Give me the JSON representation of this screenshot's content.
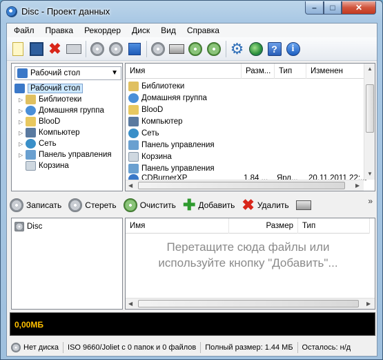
{
  "window": {
    "title": "Disc - Проект данных",
    "minimize": "–",
    "maximize": "□",
    "close": "✕"
  },
  "menu": [
    "Файл",
    "Правка",
    "Рекордер",
    "Диск",
    "Вид",
    "Справка"
  ],
  "tree": {
    "combo_value": "Рабочий стол",
    "root": "Рабочий стол",
    "items": [
      "Библиотеки",
      "Домашняя группа",
      "BlooD",
      "Компьютер",
      "Сеть",
      "Панель управления",
      "Корзина"
    ]
  },
  "file_list": {
    "columns": [
      "Имя",
      "Разм...",
      "Тип",
      "Изменен"
    ],
    "rows": [
      {
        "name": "Библиотеки"
      },
      {
        "name": "Домашняя группа"
      },
      {
        "name": "BlooD"
      },
      {
        "name": "Компьютер"
      },
      {
        "name": "Сеть"
      },
      {
        "name": "Панель управления"
      },
      {
        "name": "Корзина"
      },
      {
        "name": "Панель управления"
      }
    ],
    "partial_row": {
      "name": "CDBurnerXP",
      "size": "1,84 ...",
      "type": "Ярл...",
      "modified": "20.11.2011 22:..."
    }
  },
  "actions": {
    "burn": "Записать",
    "erase": "Стереть",
    "clear": "Очистить",
    "add": "Добавить",
    "delete": "Удалить",
    "more": "»"
  },
  "compilation": {
    "root": "Disc",
    "columns": [
      "Имя",
      "Размер",
      "Тип"
    ],
    "hint": "Перетащите сюда файлы или используйте кнопку \"Добавить\"..."
  },
  "size_display": "0,00МБ",
  "status": {
    "disc": "Нет диска",
    "fs": "ISO 9660/Joliet с 0 папок и 0 файлов",
    "total": "Полный размер: 1.44 МБ",
    "remaining": "Осталось: н/д"
  }
}
